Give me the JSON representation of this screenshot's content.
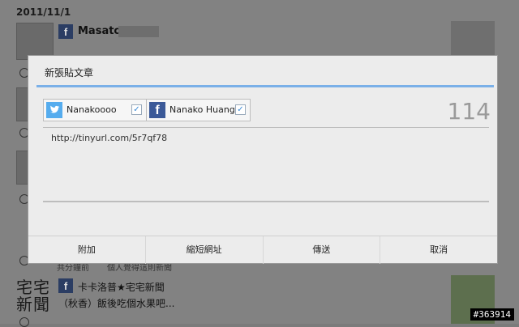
{
  "feed": {
    "date": "2011/11/1",
    "first_post": {
      "author": "Masato"
    },
    "second_post": {
      "author": "卡卡洛普★宅宅新聞",
      "text": "（秋香）飯後吃個水果吧...",
      "meta": "共分鐘前",
      "meta2": "個人覺得這則新聞"
    },
    "logo_text": "宅宅新聞"
  },
  "dialog": {
    "title": "新張貼文章",
    "accounts": [
      {
        "service": "twitter",
        "name": "Nanakoooo",
        "checked": true
      },
      {
        "service": "facebook",
        "name": "Nanako Huang",
        "checked": true
      }
    ],
    "char_count": "114",
    "post_text": "http://tinyurl.com/5r7qf78",
    "actions": {
      "attach": "附加",
      "shorten": "縮短網址",
      "send": "傳送",
      "cancel": "取消"
    }
  },
  "watermark": "#363914",
  "icons": {
    "twitter": "twitter-bird-icon",
    "facebook": "facebook-f-icon",
    "check": "checkbox-check-icon"
  },
  "colors": {
    "accent": "#7ab0e8",
    "twitter": "#55acee",
    "facebook": "#3b5998"
  }
}
